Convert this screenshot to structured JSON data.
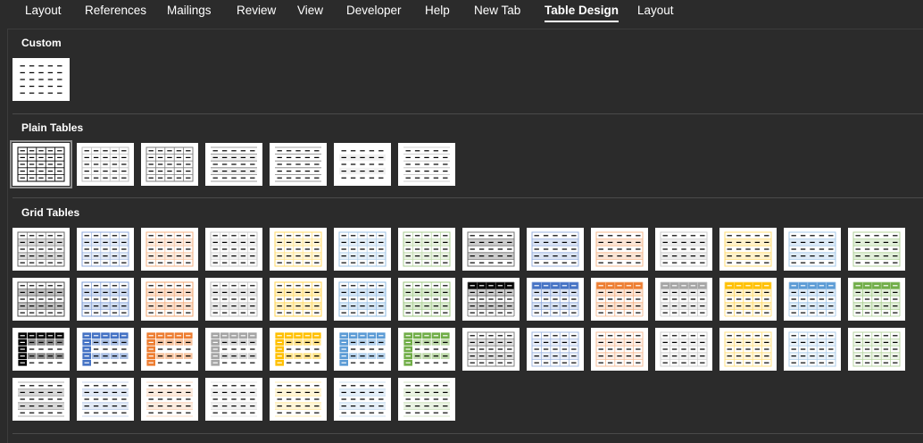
{
  "tabs": [
    {
      "label": "Layout",
      "active": false
    },
    {
      "label": "References",
      "active": false
    },
    {
      "label": "Mailings",
      "active": false
    },
    {
      "label": "Review",
      "active": false
    },
    {
      "label": "View",
      "active": false
    },
    {
      "label": "Developer",
      "active": false
    },
    {
      "label": "Help",
      "active": false
    },
    {
      "label": "New Tab",
      "active": false
    },
    {
      "label": "Table Design",
      "active": true
    },
    {
      "label": "Layout",
      "active": false
    }
  ],
  "gallery": {
    "sections": [
      {
        "title": "Custom",
        "style_count": 1
      },
      {
        "title": "Plain Tables",
        "style_count": 7,
        "selected_index": 0
      },
      {
        "title": "Grid Tables",
        "style_count": 49
      }
    ]
  },
  "colors": {
    "background": "#2b2b2b",
    "accents": [
      "#000000",
      "#4472c4",
      "#ed7d31",
      "#a5a5a5",
      "#ffc000",
      "#5b9bd5",
      "#70ad47"
    ]
  }
}
